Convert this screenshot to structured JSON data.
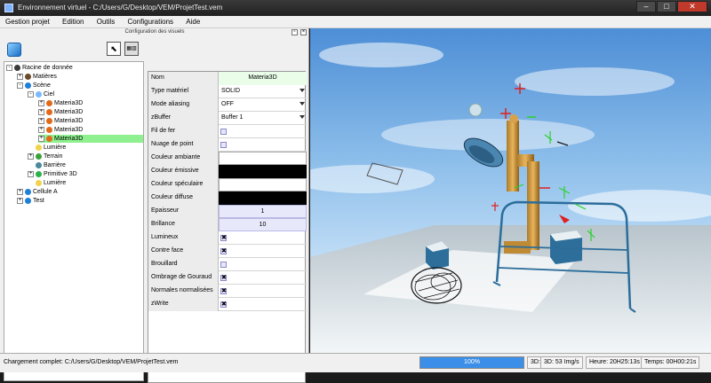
{
  "window": {
    "title": "Environnement virtuel - C:/Users/G/Desktop/VEM/ProjetTest.vem"
  },
  "menu": [
    "Gestion projet",
    "Edition",
    "Outils",
    "Configurations",
    "Aide"
  ],
  "panel": {
    "title": "Configuration des visuels"
  },
  "tree": [
    {
      "label": "Racine de donnée",
      "level": 0,
      "exp": "-",
      "icon": "computer-icon",
      "color": "#3a3a3a"
    },
    {
      "label": "Matières",
      "level": 1,
      "exp": "+",
      "icon": "materials-icon",
      "color": "#6a4a2a"
    },
    {
      "label": "Scène",
      "level": 1,
      "exp": "-",
      "icon": "globe-icon",
      "color": "#1e7fd6"
    },
    {
      "label": "Ciel",
      "level": 2,
      "exp": "-",
      "icon": "sky-icon",
      "color": "#7ab8ff"
    },
    {
      "label": "Materia3D",
      "level": 3,
      "exp": "+",
      "icon": "material-icon",
      "color": "#e06a1a"
    },
    {
      "label": "Materia3D",
      "level": 3,
      "exp": "+",
      "icon": "material-icon",
      "color": "#e06a1a"
    },
    {
      "label": "Materia3D",
      "level": 3,
      "exp": "+",
      "icon": "material-icon",
      "color": "#e06a1a"
    },
    {
      "label": "Materia3D",
      "level": 3,
      "exp": "+",
      "icon": "material-icon",
      "color": "#e06a1a"
    },
    {
      "label": "Materia3D",
      "level": 3,
      "exp": "+",
      "icon": "material-icon",
      "color": "#e06a1a",
      "selected": true
    },
    {
      "label": "Lumière",
      "level": 2,
      "exp": "",
      "icon": "light-icon",
      "color": "#f2d24a"
    },
    {
      "label": "Terrain",
      "level": 2,
      "exp": "+",
      "icon": "terrain-icon",
      "color": "#3aa23a"
    },
    {
      "label": "Barrière",
      "level": 2,
      "exp": "",
      "icon": "barrier-icon",
      "color": "#4a8a9a"
    },
    {
      "label": "Primitive 3D",
      "level": 2,
      "exp": "+",
      "icon": "primitive-icon",
      "color": "#2ab24a"
    },
    {
      "label": "Lumière",
      "level": 2,
      "exp": "",
      "icon": "light-icon",
      "color": "#f2d24a"
    },
    {
      "label": "Cellule A",
      "level": 1,
      "exp": "+",
      "icon": "globe-icon",
      "color": "#1e7fd6"
    },
    {
      "label": "Test",
      "level": 1,
      "exp": "+",
      "icon": "globe-icon",
      "color": "#1e7fd6"
    }
  ],
  "properties": [
    {
      "label": "Nom",
      "type": "text",
      "value": "Materia3D"
    },
    {
      "label": "Type matériel",
      "type": "select",
      "value": "SOLID"
    },
    {
      "label": "Mode aliasing",
      "type": "select",
      "value": "OFF"
    },
    {
      "label": "zBuffer",
      "type": "select",
      "value": "Buffer 1"
    },
    {
      "label": "Fil de fer",
      "type": "check",
      "value": ""
    },
    {
      "label": "Nuage de point",
      "type": "check",
      "value": ""
    },
    {
      "label": "Couleur ambiante",
      "type": "white",
      "value": ""
    },
    {
      "label": "Couleur émissive",
      "type": "black",
      "value": ""
    },
    {
      "label": "Couleur spéculaire",
      "type": "white",
      "value": ""
    },
    {
      "label": "Couleur diffuse",
      "type": "black",
      "value": ""
    },
    {
      "label": "Epaisseur",
      "type": "num",
      "value": "1"
    },
    {
      "label": "Brillance",
      "type": "num",
      "value": "10"
    },
    {
      "label": "Lumineux",
      "type": "check",
      "value": "✖"
    },
    {
      "label": "Contre face",
      "type": "check",
      "value": "✖"
    },
    {
      "label": "Brouillard",
      "type": "check",
      "value": ""
    },
    {
      "label": "Ombrage de Gouraud",
      "type": "check",
      "value": "✖"
    },
    {
      "label": "Normales normalisées",
      "type": "check",
      "value": "✖"
    },
    {
      "label": "zWrite",
      "type": "check",
      "value": "✖"
    }
  ],
  "status": {
    "message": "Chargement complet: C:/Users/G/Desktop/VEM/ProjetTest.vem",
    "progress_label": "100%",
    "progress_fraction": 1.0,
    "mode": "3D:",
    "fps": "3D: 53 Img/s",
    "time": "Heure: 20H25:13s",
    "elapsed": "Temps: 00H00:21s"
  }
}
